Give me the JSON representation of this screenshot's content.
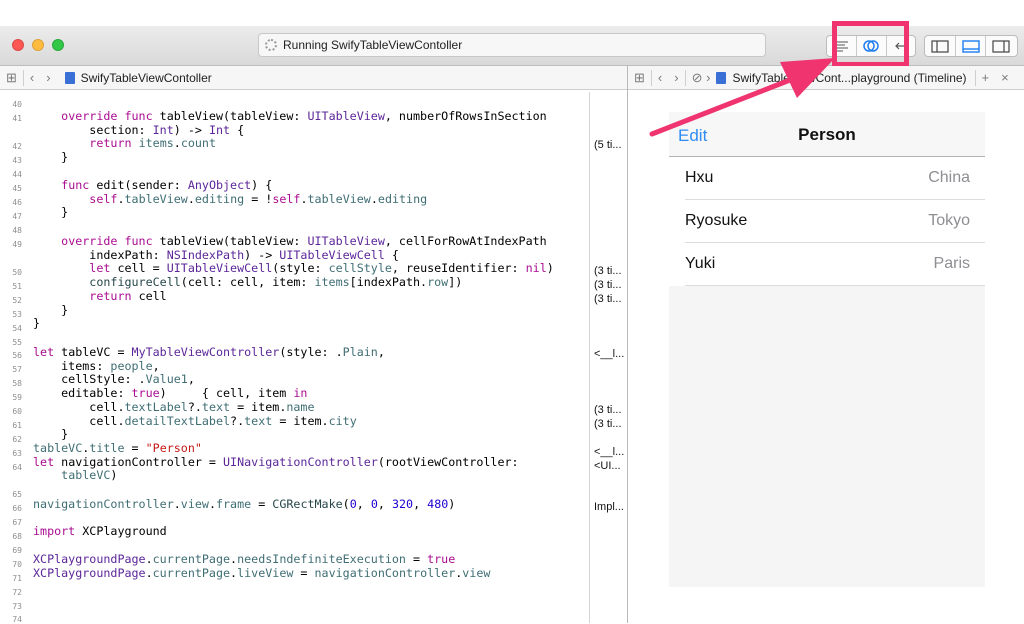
{
  "window": {
    "activity_text": "Running SwifyTableViewContoller",
    "traffic_lights": [
      "#fc5753",
      "#fdbc40",
      "#33c748"
    ]
  },
  "toolbar": {
    "editor_modes": [
      "standard-editor-icon",
      "assistant-editor-icon",
      "version-editor-icon"
    ],
    "panels": [
      "navigator-panel-icon",
      "debug-panel-icon",
      "utilities-panel-icon"
    ],
    "highlight_color": "#f0346f"
  },
  "jumpbar_left": {
    "file": "SwifyTableViewContoller"
  },
  "jumpbar_right": {
    "file": "SwifyTableViewCont...playground (Timeline)"
  },
  "editor": {
    "line_numbers": [
      "40",
      "41",
      "42",
      "43",
      "44",
      "45",
      "46",
      "47",
      "48",
      "49",
      "50",
      "51",
      "52",
      "53",
      "54",
      "55",
      "56",
      "57",
      "58",
      "59",
      "60",
      "61",
      "62",
      "63",
      "64",
      "65",
      "66",
      "67",
      "68",
      "69",
      "70",
      "71",
      "72",
      "73",
      "74"
    ],
    "results": [
      {
        "text": "(5 ti...",
        "line": 42
      },
      {
        "text": "(3 ti...",
        "line": 50
      },
      {
        "text": "(3 ti...",
        "line": 51
      },
      {
        "text": "(3 ti...",
        "line": 52
      },
      {
        "text": "<__l...",
        "line": 56
      },
      {
        "text": "(3 ti...",
        "line": 60
      },
      {
        "text": "(3 ti...",
        "line": 61
      },
      {
        "text": "<__l...",
        "line": 63
      },
      {
        "text": "<UI...",
        "line": 64
      },
      {
        "text": "Impl...",
        "line": 66
      }
    ]
  },
  "simulator": {
    "nav_left": "Edit",
    "nav_title": "Person",
    "rows": [
      {
        "name": "Hxu",
        "city": "China"
      },
      {
        "name": "Ryosuke",
        "city": "Tokyo"
      },
      {
        "name": "Yuki",
        "city": "Paris"
      }
    ]
  }
}
